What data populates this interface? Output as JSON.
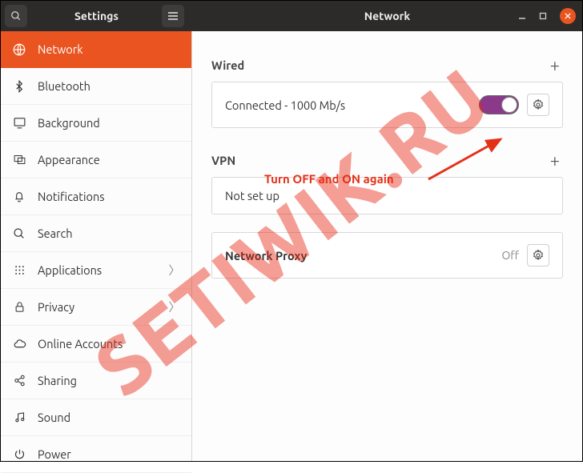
{
  "header": {
    "settings_title": "Settings",
    "page_title": "Network"
  },
  "sidebar": {
    "items": [
      {
        "label": "Network"
      },
      {
        "label": "Bluetooth"
      },
      {
        "label": "Background"
      },
      {
        "label": "Appearance"
      },
      {
        "label": "Notifications"
      },
      {
        "label": "Search"
      },
      {
        "label": "Applications"
      },
      {
        "label": "Privacy"
      },
      {
        "label": "Online Accounts"
      },
      {
        "label": "Sharing"
      },
      {
        "label": "Sound"
      },
      {
        "label": "Power"
      }
    ]
  },
  "content": {
    "wired_title": "Wired",
    "wired_status": "Connected - 1000 Mb/s",
    "vpn_title": "VPN",
    "vpn_status": "Not set up",
    "proxy_title": "Network Proxy",
    "proxy_status": "Off"
  },
  "annotation": {
    "text": "Turn OFF and ON again"
  },
  "watermark": "SETIWIK.RU"
}
